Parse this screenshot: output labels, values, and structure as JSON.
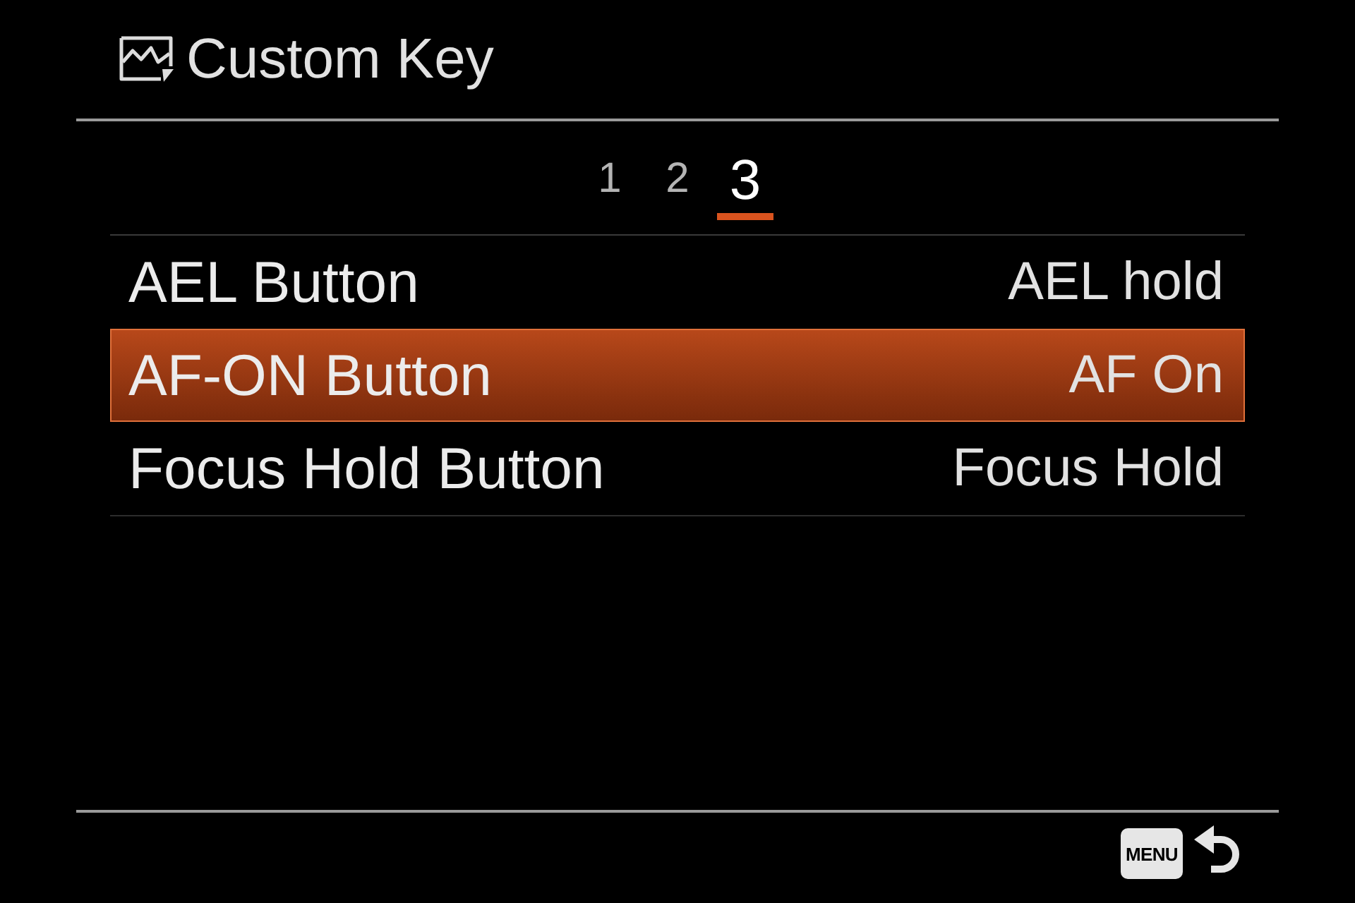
{
  "header": {
    "title": "Custom Key"
  },
  "pages": [
    {
      "label": "1",
      "selected": false
    },
    {
      "label": "2",
      "selected": false
    },
    {
      "label": "3",
      "selected": true
    }
  ],
  "items": [
    {
      "label": "AEL Button",
      "value": "AEL hold",
      "selected": false
    },
    {
      "label": "AF-ON Button",
      "value": "AF On",
      "selected": true
    },
    {
      "label": "Focus Hold Button",
      "value": "Focus Hold",
      "selected": false
    }
  ],
  "footer": {
    "menu_key": "MENU"
  }
}
